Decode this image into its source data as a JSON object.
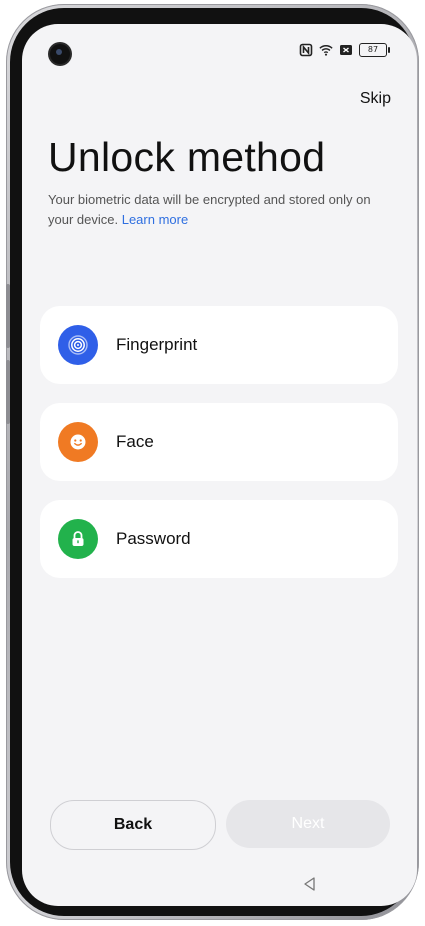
{
  "header": {
    "skip_label": "Skip"
  },
  "status_bar": {
    "battery_level": "87",
    "icons": [
      "nfc-icon",
      "wifi-icon",
      "sim-icon",
      "battery-icon"
    ]
  },
  "page": {
    "title": "Unlock method",
    "description": "Your biometric data will be encrypted and stored only on your device.",
    "learn_more": "Learn more"
  },
  "options": [
    {
      "label": "Fingerprint",
      "icon": "fingerprint-icon",
      "color": "#2f5fe8"
    },
    {
      "label": "Face",
      "icon": "face-icon",
      "color": "#f07a23"
    },
    {
      "label": "Password",
      "icon": "lock-icon",
      "color": "#22b24c"
    }
  ],
  "footer": {
    "back_label": "Back",
    "next_label": "Next"
  }
}
